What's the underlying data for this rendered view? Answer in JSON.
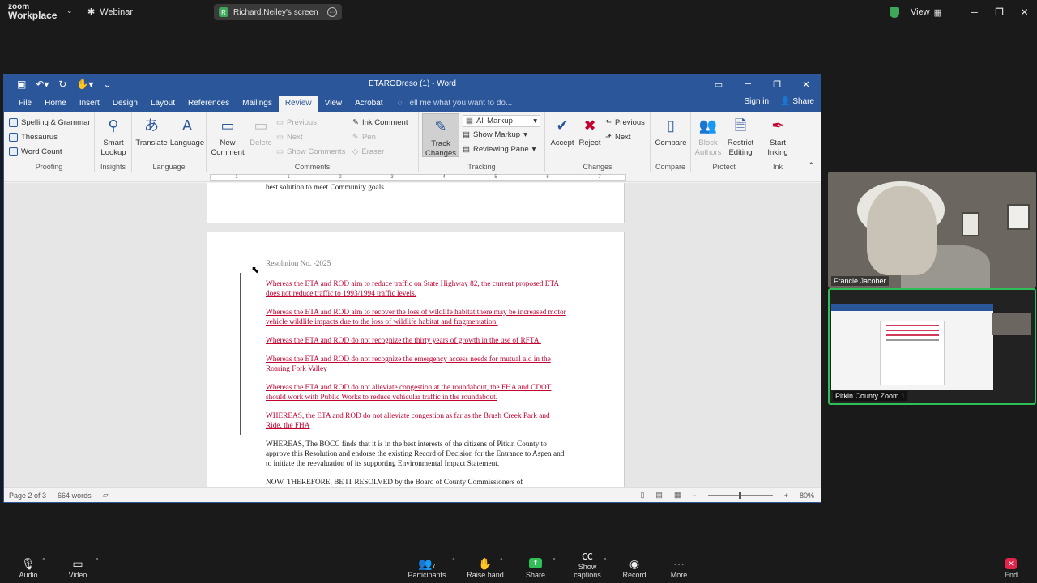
{
  "zoom": {
    "brand_line1": "zoom",
    "brand_line2": "Workplace",
    "webinar_label": "Webinar",
    "screen_label": "Richard.Neiley's screen",
    "screen_initial": "R",
    "view_label": "View"
  },
  "word": {
    "doc_title": "ETARODreso (1) - Word",
    "tabs": [
      "File",
      "Home",
      "Insert",
      "Design",
      "Layout",
      "References",
      "Mailings",
      "Review",
      "View",
      "Acrobat"
    ],
    "tell_me": "Tell me what you want to do...",
    "sign_in": "Sign in",
    "share": "Share",
    "ribbon": {
      "proofing": {
        "spelling": "Spelling & Grammar",
        "thesaurus": "Thesaurus",
        "word_count": "Word Count",
        "label": "Proofing"
      },
      "insights": {
        "smart_lookup_1": "Smart",
        "smart_lookup_2": "Lookup",
        "label": "Insights"
      },
      "language": {
        "translate": "Translate",
        "language": "Language",
        "label": "Language"
      },
      "comments": {
        "new_1": "New",
        "new_2": "Comment",
        "delete": "Delete",
        "previous": "Previous",
        "next": "Next",
        "show": "Show Comments",
        "label": "Comments"
      },
      "ink": {
        "ink_comment": "Ink Comment",
        "pen": "Pen",
        "eraser": "Eraser"
      },
      "tracking": {
        "track_1": "Track",
        "track_2": "Changes",
        "all_markup": "All Markup",
        "show_markup": "Show Markup",
        "reviewing_pane": "Reviewing Pane",
        "label": "Tracking"
      },
      "changes": {
        "accept": "Accept",
        "reject": "Reject",
        "previous": "Previous",
        "next": "Next",
        "label": "Changes"
      },
      "compare": {
        "compare": "Compare",
        "label": "Compare"
      },
      "protect": {
        "block_1": "Block",
        "block_2": "Authors",
        "restrict_1": "Restrict",
        "restrict_2": "Editing",
        "label": "Protect"
      },
      "inking": {
        "start_1": "Start",
        "start_2": "Inking",
        "label": "Ink"
      }
    },
    "ruler_ticks": [
      "1",
      "1",
      "2",
      "3",
      "4",
      "5",
      "6",
      "7"
    ],
    "page1_tail": "best solution to meet Community goals.",
    "resolution_no": "Resolution No.       -2025",
    "paragraphs": [
      {
        "text": "Whereas the ETA and ROD aim to reduce traffic on State Highway 82, the current proposed ETA does not reduce traffic to 1993/1994 traffic levels.",
        "red": true
      },
      {
        "text": "Whereas the ETA and ROD aim to recover the loss of wildlife habitat there may be increased motor vehicle wildlife impacts due to the loss of wildlife habitat and fragmentation.",
        "red": true
      },
      {
        "text": "Whereas the ETA and ROD do not recognize the thirty years of growth in the use of RFTA.",
        "red": true
      },
      {
        "text": "Whereas the ETA and ROD do not recognize the emergency access needs for mutual aid in the Roaring Fork Valley",
        "red": true
      },
      {
        "text": "Whereas the ETA and ROD do not alleviate congestion at the roundabout, the FHA and CDOT should work with Public Works to reduce vehicular traffic in the roundabout.",
        "red": true
      },
      {
        "text": "WHEREAS, the ETA and ROD do not alleviate congestion as far as the Brush Creek Park and Ride, the FHA",
        "red": true
      },
      {
        "text": "WHEREAS, The BOCC finds that it is in the best interests of the citizens of Pitkin County to approve this Resolution and endorse the existing Record of Decision for the Entrance to Aspen and to initiate the reevaluation of its supporting Environmental Impact Statement.",
        "red": false
      },
      {
        "text": "NOW, THEREFORE, BE IT RESOLVED by the Board of County Commissioners of",
        "red": false
      }
    ],
    "status": {
      "page": "Page 2 of 3",
      "words": "664 words",
      "zoom": "80%"
    }
  },
  "participants": {
    "tile1_name": "Francie Jacober",
    "tile2_name": "Pitkin County Zoom 1"
  },
  "toolbar": {
    "audio": "Audio",
    "video": "Video",
    "participants": "Participants",
    "participants_count": "7",
    "raise_hand": "Raise hand",
    "share": "Share",
    "captions": "Show captions",
    "record": "Record",
    "more": "More",
    "end": "End"
  },
  "colors": {
    "word_blue": "#2b579a",
    "zoom_green": "#2fbf56",
    "track_red": "#c4002f",
    "end_red": "#e0244a"
  }
}
